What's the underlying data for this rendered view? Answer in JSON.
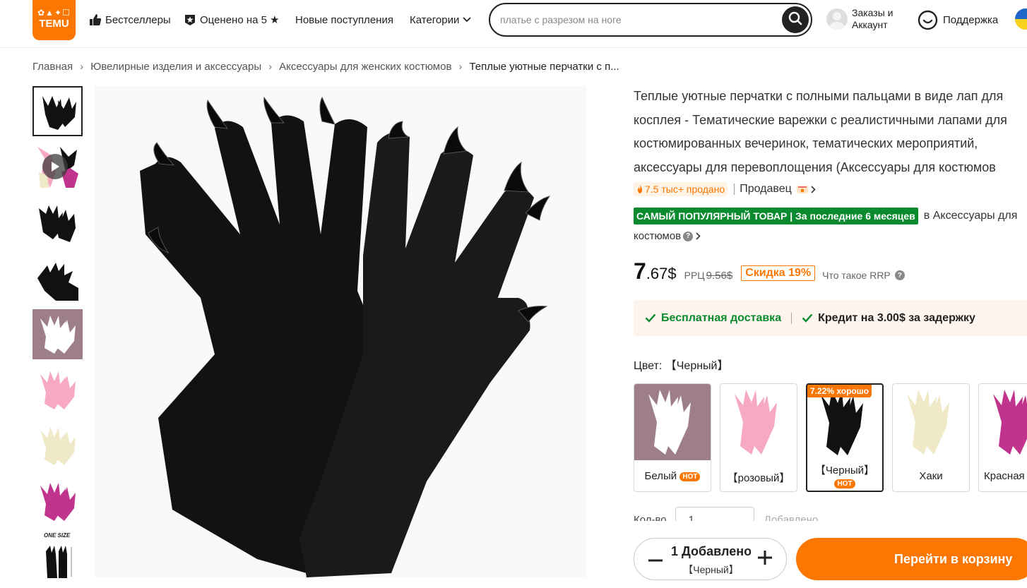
{
  "header": {
    "logo_glyphs": "✿▲✦☐",
    "logo_text": "TEMU",
    "nav": {
      "bestsellers": "Бестселлеры",
      "rated5": "Оценено на 5 ★",
      "new_arrivals": "Новые поступления",
      "categories": "Категории"
    },
    "search_placeholder": "платье с разрезом на ноге",
    "account_line1": "Заказы и",
    "account_line2": "Аккаунт",
    "support": "Поддержка"
  },
  "breadcrumb": {
    "items": [
      "Главная",
      "Ювелирные изделия и аксессуары",
      "Аксессуары для женских костюмов"
    ],
    "current": "Теплые уютные перчатки с п..."
  },
  "thumbnails": {
    "size_label": "ONE SIZE",
    "colors": [
      "#111111",
      "#f6a9c0",
      "#111111",
      "#111111",
      "#ffffff",
      "#f6a9c0",
      "#efe9c8",
      "#c0348e",
      "#111111"
    ]
  },
  "product": {
    "title_lines": [
      "Теплые уютные перчатки с полными пальцами в виде лап для",
      "косплея - Тематические варежки с реалистичными лапами для",
      "костюмированных вечеринок, тематических мероприятий,",
      "аксессуары для перевоплощения (Аксессуары для костюмов"
    ],
    "sold": "7.5 тыс+ продано",
    "seller": "Продавец",
    "badge": "САМЫЙ ПОПУЛЯРНЫЙ ТОВАР | За последние 6 месяцев",
    "badge_category_1": "в Аксессуары для",
    "badge_category_2": "костюмов",
    "price_int": "7",
    "price_frac": ".67$",
    "rrp_label": "РРЦ",
    "rrp_value": "9.56$",
    "discount": "Скидка 19%",
    "what_rrp": "Что такое RRP",
    "shipping_free": "Бесплатная доставка",
    "shipping_credit": "Кредит на 3.00$ за задержку",
    "color_label": "Цвет:",
    "color_value": "【Черный】",
    "swatches": [
      {
        "name": "Белый",
        "hot": "HOT",
        "color": "#ffffff",
        "bg": "#9e7f89"
      },
      {
        "name": "【розовый】",
        "color": "#f6a9c0",
        "bg": "#ffffff"
      },
      {
        "name": "【Черный】",
        "hot": "HOT",
        "promo": "7.22% хорошо",
        "color": "#111111",
        "bg": "#ffffff"
      },
      {
        "name": "Хаки",
        "color": "#efe9c8",
        "bg": "#ffffff"
      },
      {
        "name": "Красная",
        "color": "#c0348e",
        "bg": "#ffffff"
      }
    ],
    "qty_label": "Кол-во",
    "qty_value": "1",
    "qty_added": "Добавлено"
  },
  "bottom": {
    "stepper_line1": "1 Добавлено",
    "stepper_line2": "【Черный】",
    "cart_button": "Перейти в корзину"
  },
  "colors": {
    "accent": "#fb7701",
    "green": "#0a8a2e"
  }
}
